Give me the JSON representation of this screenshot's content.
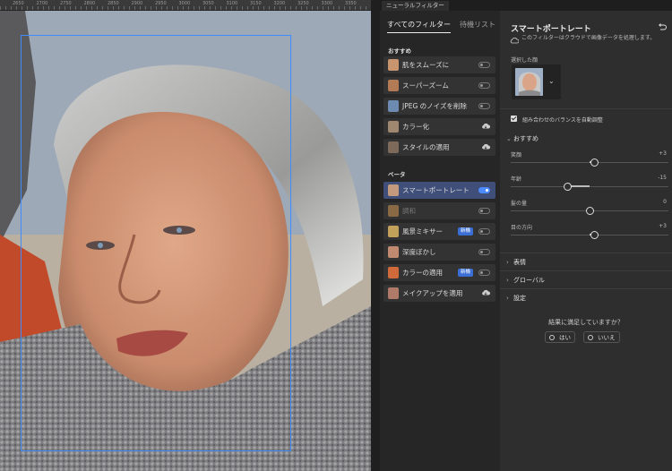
{
  "window": {
    "panel_tab": "ニューラルフィルター"
  },
  "ruler": {
    "ticks": [
      "2650",
      "2700",
      "2750",
      "2800",
      "2850",
      "2900",
      "2950",
      "3000",
      "3050",
      "3100",
      "3150",
      "3200",
      "3250",
      "3300",
      "3350"
    ]
  },
  "filters": {
    "tabs": [
      {
        "label": "すべてのフィルター",
        "active": true
      },
      {
        "label": "待機リスト",
        "active": false
      }
    ],
    "featured_header": "おすすめ",
    "featured": [
      {
        "name": "肌をスムーズに",
        "control": "toggle",
        "on": false,
        "thumb": "#c9956f"
      },
      {
        "name": "スーパーズーム",
        "control": "toggle",
        "on": false,
        "thumb": "#b27a55"
      },
      {
        "name": "JPEG のノイズを削除",
        "control": "toggle",
        "on": false,
        "thumb": "#6d8bb0"
      },
      {
        "name": "カラー化",
        "control": "cloud",
        "thumb": "#a08870"
      },
      {
        "name": "スタイルの適用",
        "control": "cloud",
        "thumb": "#7e6a5a"
      }
    ],
    "beta_header": "ベータ",
    "beta": [
      {
        "name": "スマートポートレート",
        "control": "toggle",
        "on": true,
        "selected": true,
        "thumb": "#c39a7e"
      },
      {
        "name": "調和",
        "control": "toggle",
        "on": false,
        "disabled": true,
        "thumb": "#8a6a44"
      },
      {
        "name": "風景ミキサー",
        "control": "toggle",
        "on": false,
        "badge": "新機",
        "thumb": "#c2a15a"
      },
      {
        "name": "深度ぼかし",
        "control": "toggle",
        "on": false,
        "thumb": "#c08a70"
      },
      {
        "name": "カラーの適用",
        "control": "toggle",
        "on": false,
        "badge": "新機",
        "thumb": "#d06a3a"
      },
      {
        "name": "メイクアップを適用",
        "control": "cloud",
        "thumb": "#b07a68"
      }
    ]
  },
  "settings": {
    "title": "スマートポートレート",
    "description": "このフィルターはクラウドで画像データを処理します。",
    "selected_face_label": "選択した顔",
    "auto_balance": {
      "label": "組み合わせのバランスを自動調整",
      "checked": true
    },
    "recommended_header": "おすすめ",
    "sliders": [
      {
        "label": "笑顔",
        "value": "+3",
        "position": 0.53
      },
      {
        "label": "年齢",
        "value": "-15",
        "position": 0.36
      },
      {
        "label": "髪の量",
        "value": "0",
        "position": 0.5
      },
      {
        "label": "目の方向",
        "value": "+3",
        "position": 0.53
      }
    ],
    "collapsed_sections": [
      "表情",
      "グローバル",
      "設定"
    ],
    "feedback": {
      "question": "結果に満足していますか？",
      "yes": "はい",
      "no": "いいえ"
    }
  }
}
